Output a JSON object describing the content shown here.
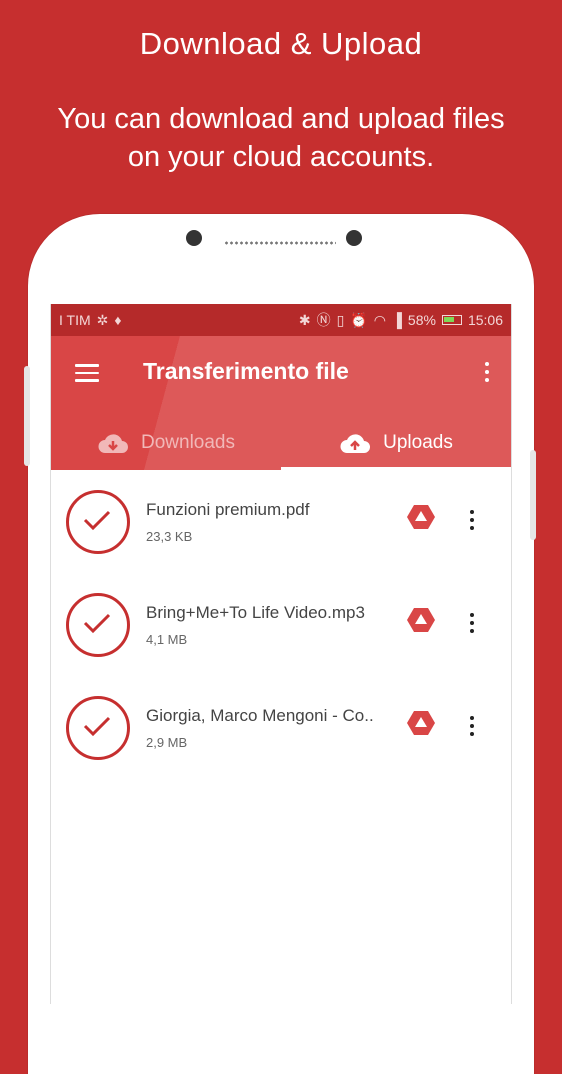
{
  "promo": {
    "title": "Download & Upload",
    "subtitle_line1": "You can download and upload files",
    "subtitle_line2": "on your cloud accounts."
  },
  "statusbar": {
    "carrier": "I TIM",
    "battery": "58%",
    "time": "15:06"
  },
  "appbar": {
    "title": "Transferimento file"
  },
  "tabs": [
    {
      "label": "Downloads",
      "icon": "cloud-download-icon",
      "active": false
    },
    {
      "label": "Uploads",
      "icon": "cloud-upload-icon",
      "active": true
    }
  ],
  "files": [
    {
      "name": "Funzioni premium.pdf",
      "size": "23,3 KB",
      "status_icon": "check-circle-icon",
      "service_icon": "google-drive-icon"
    },
    {
      "name": "Bring+Me+To Life Video.mp3",
      "size": "4,1 MB",
      "status_icon": "check-circle-icon",
      "service_icon": "google-drive-icon"
    },
    {
      "name": "Giorgia, Marco Mengoni - Co..",
      "size": "2,9 MB",
      "status_icon": "check-circle-icon",
      "service_icon": "google-drive-icon"
    }
  ],
  "colors": {
    "background": "#c62f2f",
    "appbar": "#d94646",
    "statusbar": "#b52a2a",
    "accent": "#c62f2f"
  }
}
